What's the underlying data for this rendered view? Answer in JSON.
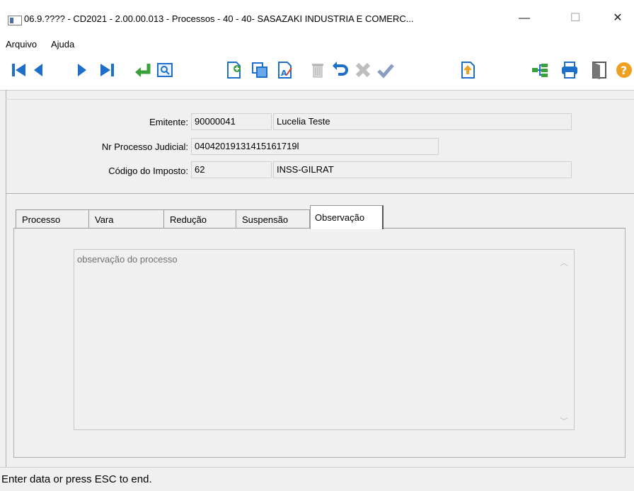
{
  "window": {
    "title": "06.9.???? - CD2021 - 2.00.00.013 - Processos - 40 - 40- SASAZAKI INDUSTRIA E COMERC...",
    "minimize": "—",
    "maximize": "☐",
    "close": "✕"
  },
  "menu": {
    "items": [
      "Arquivo",
      "Ajuda"
    ]
  },
  "toolbar": {
    "icons": [
      "first-record-icon",
      "previous-record-icon",
      "next-record-icon",
      "last-record-icon",
      "return-icon",
      "zoom-icon",
      "new-record-icon",
      "copy-record-icon",
      "edit-record-icon",
      "delete-record-icon",
      "undo-icon",
      "cancel-icon",
      "confirm-icon",
      "up-arrow-icon",
      "tree-icon",
      "print-icon",
      "exit-door-icon",
      "help-icon"
    ]
  },
  "form": {
    "emitente_label": "Emitente:",
    "emitente_code": "90000041",
    "emitente_name": "Lucelia Teste",
    "processo_label": "Nr Processo Judicial:",
    "processo_value": "04042019131415161719l",
    "imposto_label": "Código do Imposto:",
    "imposto_code": "62",
    "imposto_name": "INSS-GILRAT"
  },
  "tabs": {
    "items": [
      "Processo",
      "Vara",
      "Redução",
      "Suspensão",
      "Observação"
    ],
    "active": "Observação"
  },
  "observacao": {
    "text": "observação do  processo"
  },
  "status": {
    "text": "Enter data or press ESC to end."
  }
}
